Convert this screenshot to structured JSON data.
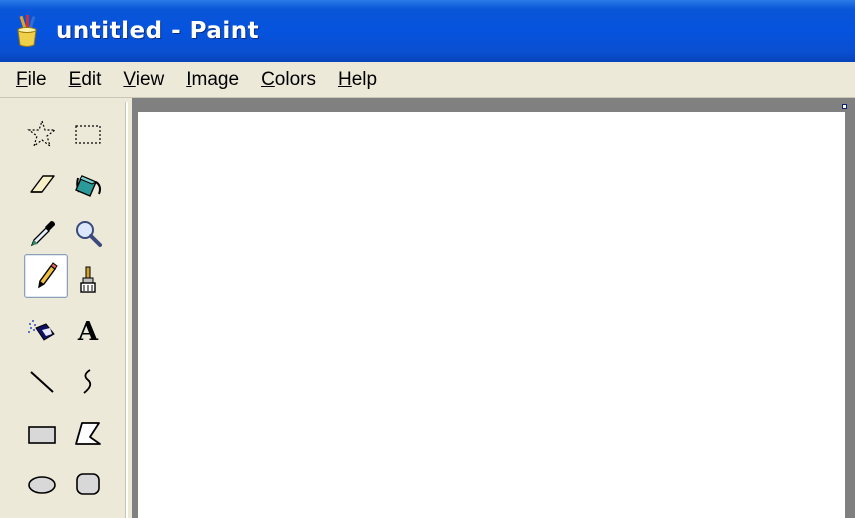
{
  "window": {
    "title": "untitled - Paint"
  },
  "menu": {
    "items": [
      {
        "label": "File",
        "mnemonic": "F",
        "rest": "ile"
      },
      {
        "label": "Edit",
        "mnemonic": "E",
        "rest": "dit"
      },
      {
        "label": "View",
        "mnemonic": "V",
        "rest": "iew"
      },
      {
        "label": "Image",
        "mnemonic": "I",
        "rest": "mage"
      },
      {
        "label": "Colors",
        "mnemonic": "C",
        "rest": "olors"
      },
      {
        "label": "Help",
        "mnemonic": "H",
        "rest": "elp"
      }
    ]
  },
  "tools": {
    "items": [
      {
        "name": "free-form-select",
        "icon": "free-form-select-icon"
      },
      {
        "name": "rectangle-select",
        "icon": "rectangle-select-icon"
      },
      {
        "name": "eraser",
        "icon": "eraser-icon"
      },
      {
        "name": "fill-with-color",
        "icon": "paint-bucket-icon"
      },
      {
        "name": "pick-color",
        "icon": "eyedropper-icon"
      },
      {
        "name": "magnifier",
        "icon": "magnifier-icon"
      },
      {
        "name": "pencil",
        "icon": "pencil-icon",
        "selected": true
      },
      {
        "name": "brush",
        "icon": "brush-icon"
      },
      {
        "name": "airbrush",
        "icon": "airbrush-icon"
      },
      {
        "name": "text",
        "icon": "text-icon",
        "glyph": "A"
      },
      {
        "name": "line",
        "icon": "line-icon"
      },
      {
        "name": "curve",
        "icon": "curve-icon"
      },
      {
        "name": "rectangle",
        "icon": "rectangle-icon"
      },
      {
        "name": "polygon",
        "icon": "polygon-icon"
      },
      {
        "name": "ellipse",
        "icon": "ellipse-icon"
      },
      {
        "name": "rounded-rectangle",
        "icon": "rounded-rectangle-icon"
      }
    ]
  },
  "colors": {
    "titlebar": "#0553de",
    "chrome": "#ece9d8",
    "workspace": "#808080",
    "canvas": "#ffffff"
  }
}
